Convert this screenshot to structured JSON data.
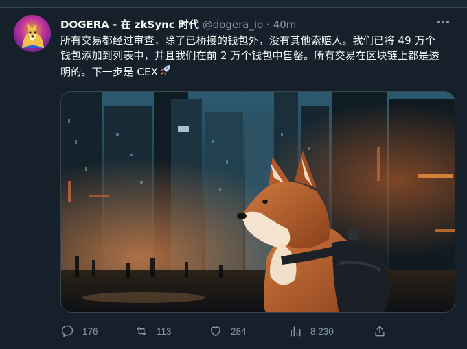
{
  "tweet": {
    "author": {
      "display_name": "DOGERA - 在 zkSync 时代",
      "handle": "@dogera_io",
      "separator": "·",
      "time": "40m"
    },
    "text": "所有交易都经过审查，除了已桥接的钱包外，没有其他索赔人。我们已将 49 万个钱包添加到列表中，并且我们在前 2 万个钱包中售罄。所有交易在区块链上都是透明的。下一步是 CEX",
    "actions": {
      "replies": "176",
      "retweets": "113",
      "likes": "284",
      "views": "8,230"
    }
  },
  "icons": {
    "more": "more-horizontal-icon",
    "reply": "reply-icon",
    "retweet": "retweet-icon",
    "like": "heart-icon",
    "views": "views-chart-icon",
    "share": "share-icon",
    "emoji": "rocket-emoji"
  },
  "colors": {
    "background": "#15202b",
    "text_primary": "#f7f9f9",
    "text_secondary": "#8b98a5",
    "border": "#38444d"
  }
}
